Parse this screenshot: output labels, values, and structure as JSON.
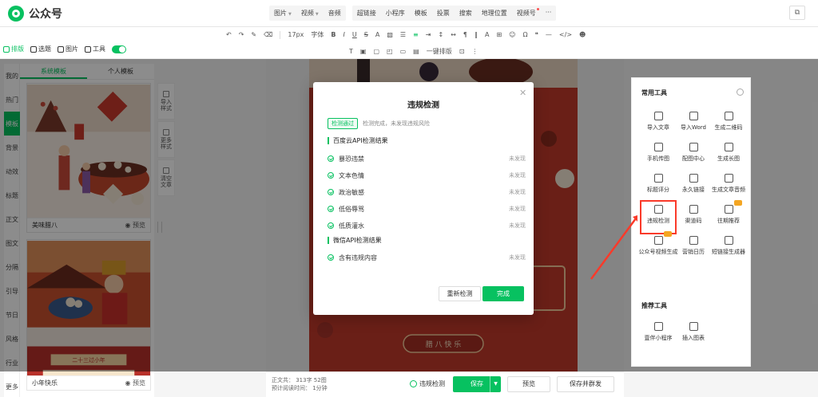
{
  "app": {
    "title": "公众号"
  },
  "insert_menu": [
    [
      "图片",
      "视频",
      "音频"
    ],
    [
      "超链接",
      "小程序",
      "模板",
      "投票",
      "搜索",
      "地理位置",
      "视频号",
      "···"
    ]
  ],
  "toolbar": {
    "font_size": "17px",
    "font_family": "字体",
    "row2_label": "一键排版"
  },
  "left_tabs": {
    "layout": "排版",
    "topic": "选题",
    "image": "图片",
    "tools": "工具"
  },
  "vnav": [
    "我的",
    "热门",
    "模板",
    "背景",
    "动效",
    "标题",
    "正文",
    "图文",
    "分隔",
    "引导",
    "节日",
    "风格",
    "行业",
    "更多"
  ],
  "template_panel": {
    "tabs": [
      "系统模板",
      "个人模板"
    ],
    "cards": [
      {
        "title": "美味腊八",
        "preview": "预览"
      },
      {
        "title": "",
        "preview": ""
      },
      {
        "title": "小年快乐",
        "preview": "预览"
      }
    ]
  },
  "mid_tools": [
    "导入样式",
    "更多样式",
    "清空文章"
  ],
  "article": {
    "banner": "腊 八 快 乐"
  },
  "right_panel": {
    "common_title": "常用工具",
    "tools": [
      {
        "label": "导入文章",
        "icon": "download-icon"
      },
      {
        "label": "导入Word",
        "icon": "word-icon"
      },
      {
        "label": "生成二维码",
        "icon": "qrcode-icon"
      },
      {
        "label": "手机传图",
        "icon": "phone-icon"
      },
      {
        "label": "配图中心",
        "icon": "image-icon"
      },
      {
        "label": "生成长图",
        "icon": "long-image-icon"
      },
      {
        "label": "标题评分",
        "icon": "title-icon"
      },
      {
        "label": "永久链接",
        "icon": "link-icon"
      },
      {
        "label": "生成文章音频",
        "icon": "music-icon"
      },
      {
        "label": "违规检测",
        "icon": "shield-icon"
      },
      {
        "label": "渠道码",
        "icon": "channel-code-icon"
      },
      {
        "label": "往期推荐",
        "icon": "thumb-icon"
      },
      {
        "label": "公众号视频生成",
        "icon": "video-icon"
      },
      {
        "label": "营销日历",
        "icon": "calendar-icon"
      },
      {
        "label": "短链接生成器",
        "icon": "short-link-icon"
      }
    ],
    "recommend_title": "推荐工具",
    "recommend": [
      {
        "label": "壹伴小程序",
        "icon": "miniapp-icon"
      },
      {
        "label": "插入图表",
        "icon": "chart-icon"
      }
    ]
  },
  "bottom_bar": {
    "word_count": "正文共：  313字 52图",
    "read_time": "预计阅读时间：  1分钟",
    "check_label": "违规检测",
    "save": "保存",
    "preview": "预览",
    "save_group": "保存并群发"
  },
  "modal": {
    "title": "违规检测",
    "status_tag": "检测通过",
    "status_msg": "检测完成，未发现违规风险",
    "baidu_title": "百度云API检测结果",
    "baidu_items": [
      {
        "label": "暴恐违禁",
        "result": "未发现"
      },
      {
        "label": "文本色情",
        "result": "未发现"
      },
      {
        "label": "政治敏感",
        "result": "未发现"
      },
      {
        "label": "低俗辱骂",
        "result": "未发现"
      },
      {
        "label": "低质灌水",
        "result": "未发现"
      }
    ],
    "wechat_title": "微信API检测结果",
    "wechat_items": [
      {
        "label": "含有违规内容",
        "result": "未发现"
      }
    ],
    "recheck": "重新检测",
    "done": "完成"
  },
  "colors": {
    "brand": "#07c160",
    "highlight": "#fa3a2a",
    "article_bg": "#c23a2b"
  }
}
